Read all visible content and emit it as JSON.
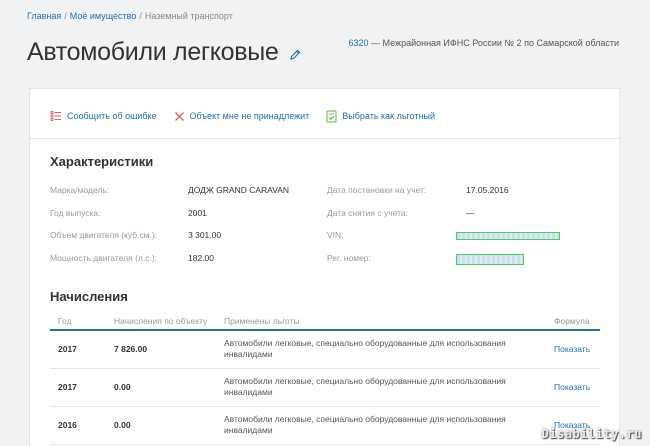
{
  "breadcrumb": {
    "home": "Главная",
    "property": "Моё имущество",
    "current": "Наземный транспорт"
  },
  "page_title": "Автомобили легковые",
  "tax_office": {
    "code": "6320",
    "name": " — Межрайонная ИФНС России № 2 по Самарской области"
  },
  "actions": {
    "report_error": "Сообщить об ошибке",
    "not_mine": "Объект мне не принадлежит",
    "choose_preferential": "Выбрать как льготный"
  },
  "characteristics": {
    "title": "Характеристики",
    "make_model_label": "Марка/модель:",
    "make_model": "ДОДЖ GRAND CARAVAN",
    "year_label": "Год выпуска:",
    "year": "2001",
    "engine_volume_label": "Объем двигателя (куб.см.):",
    "engine_volume": "3 301.00",
    "power_label": "Мощность двигателя (л.с.):",
    "power": "182.00",
    "reg_date_label": "Дата постановки на учет:",
    "reg_date": "17.05.2016",
    "dereg_date_label": "Дата снятия с учета:",
    "dereg_date": "—",
    "vin_label": "VIN:",
    "plate_label": "Рег. номер:"
  },
  "accruals": {
    "title": "Начисления",
    "columns": {
      "year": "Год",
      "amount": "Начисления по объекту",
      "benefit": "Применены льготы",
      "formula": "Формула"
    },
    "rows": [
      {
        "year": "2017",
        "amount": "7 826.00",
        "benefit": "Автомобили легковые, специально оборудованные для использования инвалидами",
        "formula": "Показать"
      },
      {
        "year": "2017",
        "amount": "0.00",
        "benefit": "Автомобили легковые, специально оборудованные для использования инвалидами",
        "formula": "Показать"
      },
      {
        "year": "2016",
        "amount": "0.00",
        "benefit": "Автомобили легковые, специально оборудованные для использования инвалидами",
        "formula": "Показать"
      }
    ]
  },
  "watermark": "Disability.ru",
  "colors": {
    "link": "#1f6fb2",
    "error_icon": "#e05b5b",
    "not_mine_icon": "#e05b5b",
    "preferential_icon": "#6ab04c",
    "mask_border": "#45cf5f"
  }
}
